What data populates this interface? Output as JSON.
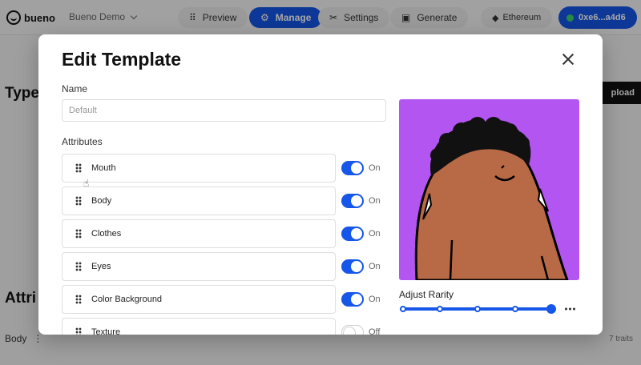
{
  "app": {
    "logo_text": "bueno",
    "project_name": "Bueno Demo",
    "nav": [
      {
        "label": "Preview",
        "icon": "grid-icon"
      },
      {
        "label": "Manage",
        "icon": "manage-icon"
      },
      {
        "label": "Settings",
        "icon": "tools-icon"
      },
      {
        "label": "Generate",
        "icon": "image-icon"
      }
    ],
    "chain": "Ethereum",
    "wallet": "0xe6...a4d6",
    "heading_types": "Type",
    "heading_attributes": "Attri",
    "upload_label": "pload",
    "body_label": "Body",
    "traits_count": "7 traits"
  },
  "modal": {
    "title": "Edit Template",
    "name_label": "Name",
    "name_placeholder": "Default",
    "attributes_label": "Attributes",
    "attributes": [
      {
        "name": "Mouth",
        "state": "On"
      },
      {
        "name": "Body",
        "state": "On"
      },
      {
        "name": "Clothes",
        "state": "On"
      },
      {
        "name": "Eyes",
        "state": "On"
      },
      {
        "name": "Color Background",
        "state": "On"
      },
      {
        "name": "Texture",
        "state": "Off"
      }
    ],
    "rarity_label": "Adjust Rarity",
    "preview_bg": "#b355f0",
    "accent": "#1656e8"
  }
}
